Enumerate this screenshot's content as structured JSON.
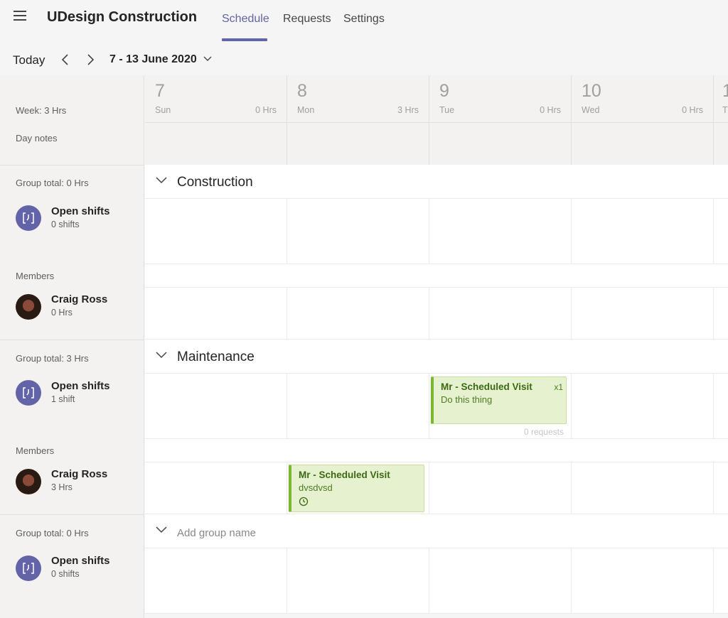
{
  "app": {
    "title": "UDesign Construction"
  },
  "tabs": [
    {
      "label": "Schedule",
      "active": true
    },
    {
      "label": "Requests",
      "active": false
    },
    {
      "label": "Settings",
      "active": false
    }
  ],
  "nav": {
    "today": "Today",
    "date_range": "7 - 13 June 2020"
  },
  "summary": {
    "week": "Week: 3 Hrs",
    "day_notes": "Day notes"
  },
  "days": [
    {
      "num": "7",
      "name": "Sun",
      "hrs": "0 Hrs"
    },
    {
      "num": "8",
      "name": "Mon",
      "hrs": "3 Hrs"
    },
    {
      "num": "9",
      "name": "Tue",
      "hrs": "0 Hrs"
    },
    {
      "num": "10",
      "name": "Wed",
      "hrs": "0 Hrs"
    },
    {
      "num": "1",
      "name": "T",
      "hrs": ""
    }
  ],
  "groups": [
    {
      "name": "Construction",
      "total": "Group total: 0 Hrs",
      "open_shifts": {
        "label": "Open shifts",
        "count": "0 shifts"
      },
      "members_label": "Members",
      "member": {
        "name": "Craig Ross",
        "hrs": "0 Hrs"
      }
    },
    {
      "name": "Maintenance",
      "total": "Group total: 3 Hrs",
      "open_shifts": {
        "label": "Open shifts",
        "count": "1 shift"
      },
      "members_label": "Members",
      "member": {
        "name": "Craig Ross",
        "hrs": "3 Hrs"
      },
      "open_shift_card": {
        "title": "Mr - Scheduled Visit",
        "note": "Do this thing",
        "count": "x1",
        "requests": "0 requests"
      },
      "member_shift_card": {
        "title": "Mr - Scheduled Visit",
        "note": "dvsdvsd"
      }
    },
    {
      "name_placeholder": "Add group name",
      "total": "Group total: 0 Hrs",
      "open_shifts": {
        "label": "Open shifts",
        "count": "0 shifts"
      }
    }
  ],
  "colors": {
    "accent": "#6264a7",
    "shift_fill": "#e6f2cf",
    "shift_border": "#7cb82f"
  }
}
